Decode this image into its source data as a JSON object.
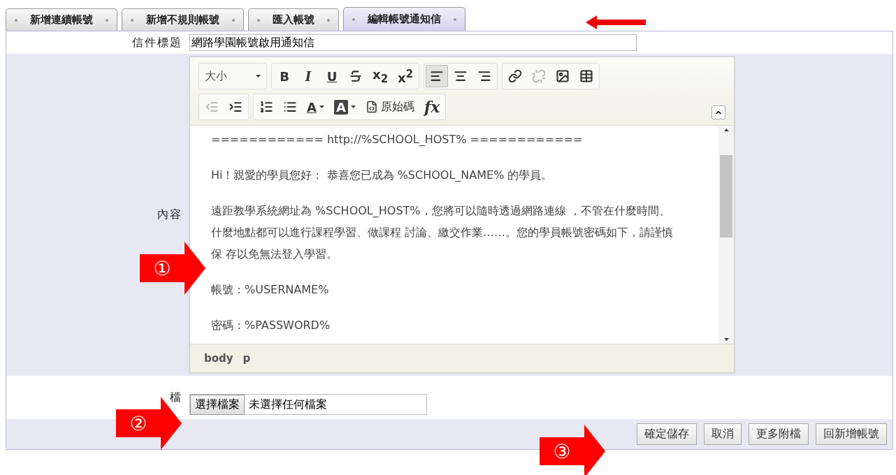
{
  "tabs": [
    {
      "label": "新增連續帳號",
      "selected": false
    },
    {
      "label": "新增不規則帳號",
      "selected": false
    },
    {
      "label": "匯入帳號",
      "selected": false
    },
    {
      "label": "編輯帳號通知信",
      "selected": true
    }
  ],
  "form": {
    "subject": {
      "label": "信件標題",
      "value": "網路學園帳號啟用通知信"
    },
    "content": {
      "label": "內容",
      "toolbar": [
        [
          [
            {
              "kind": "dropdown",
              "label": "大小"
            }
          ],
          [
            {
              "kind": "bold",
              "label": "B"
            },
            {
              "kind": "italic",
              "label": "I"
            },
            {
              "kind": "underline",
              "label": "U"
            },
            {
              "kind": "strike"
            },
            {
              "kind": "sub",
              "label": "x$_{2}$"
            },
            {
              "kind": "sup",
              "label": "x$^{2}$"
            }
          ],
          [
            {
              "kind": "align-left",
              "selected": true
            },
            {
              "kind": "align-center",
              "selected": false
            },
            {
              "kind": "align-right",
              "selected": false
            }
          ],
          [
            {
              "kind": "link",
              "disabled": false
            },
            {
              "kind": "unlink",
              "disabled": true
            },
            {
              "kind": "image",
              "disabled": false
            },
            {
              "kind": "table",
              "disabled": false
            }
          ]
        ],
        [
          [
            {
              "kind": "outdent",
              "disabled": true
            },
            {
              "kind": "indent",
              "disabled": false
            }
          ],
          [
            {
              "kind": "numbered-list"
            },
            {
              "kind": "bullet-list"
            },
            {
              "kind": "text-color",
              "label": "A"
            },
            {
              "kind": "bg-color",
              "label": "A"
            },
            {
              "kind": "source",
              "label": "原始碼"
            },
            {
              "kind": "remove-format",
              "label": "fx"
            }
          ]
        ]
      ],
      "paragraphs": [
        "============ http://%SCHOOL_HOST% ============",
        "Hi！親愛的學員您好： 恭喜您已成為 %SCHOOL_NAME% 的學員。",
        "遠距教學系統網址為 %SCHOOL_HOST%，您將可以隨時透過網路連線 ，不管在什麼時間、什麼地點都可以進行課程學習、做課程 討論、繳交作業……。您的學員帳號密碼如下，請謹慎保 存以免無法登入學習。",
        "帳號：%USERNAME%",
        "密碼：%PASSWORD%"
      ],
      "path": [
        "body",
        "p"
      ]
    },
    "attachment": {
      "label": "檔",
      "button": "選擇檔案",
      "status": "未選擇任何檔案"
    },
    "buttons": [
      "確定儲存",
      "取消",
      "更多附檔",
      "回新增帳號"
    ]
  },
  "annotations": [
    {
      "kind": "tab-arrow"
    },
    {
      "kind": "number-arrow",
      "label": "①"
    },
    {
      "kind": "number-arrow",
      "label": "②"
    },
    {
      "kind": "number-arrow",
      "label": "③"
    }
  ]
}
